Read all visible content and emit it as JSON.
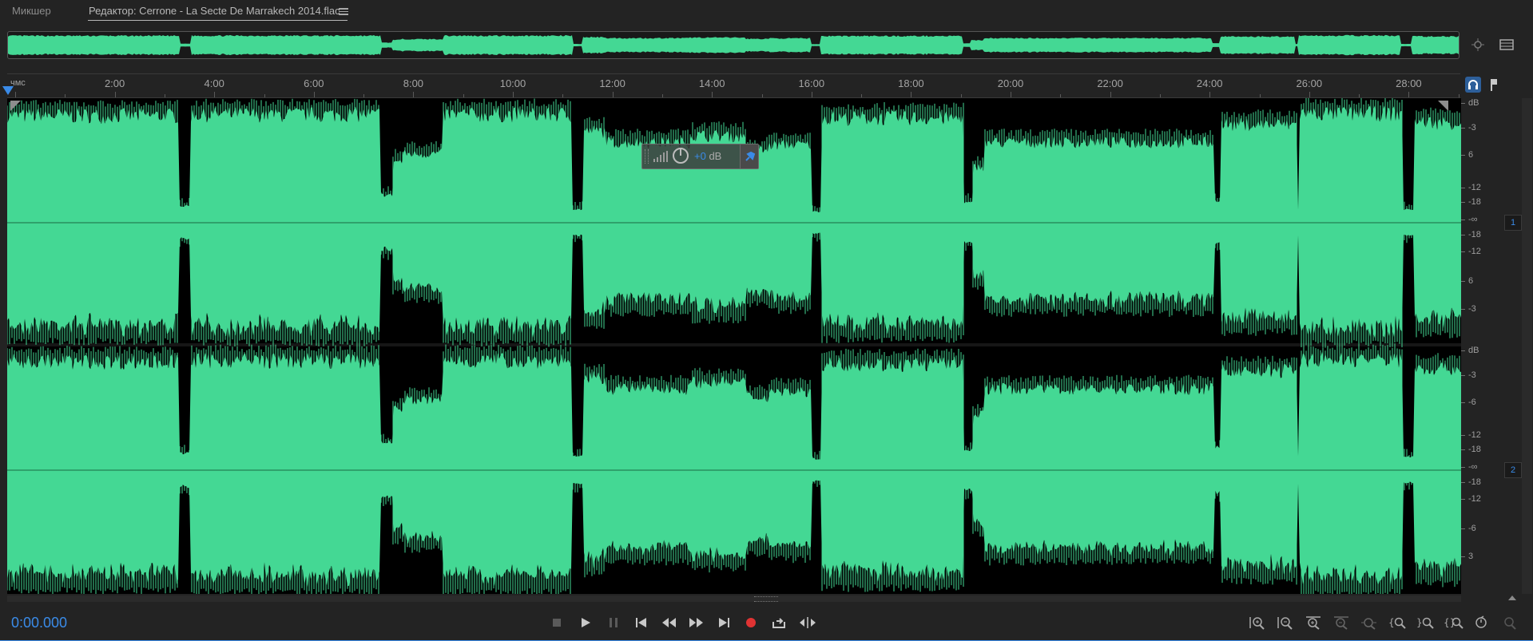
{
  "tabs": {
    "mixer_label": "Микшер",
    "editor_label": "Редактор: Cerrone - La Secte De Marrakech 2014.flac"
  },
  "ruler": {
    "unit_label": "чмс",
    "ticks": [
      "2:00",
      "4:00",
      "6:00",
      "8:00",
      "10:00",
      "12:00",
      "14:00",
      "16:00",
      "18:00",
      "20:00",
      "22:00",
      "24:00",
      "26:00",
      "28:00"
    ]
  },
  "channels": [
    {
      "badge": "1",
      "scale_labels": [
        "dB",
        "-3",
        "6",
        "-12",
        "-18",
        "-∞",
        "-18",
        "-12",
        "6",
        "-3"
      ]
    },
    {
      "badge": "2",
      "scale_labels": [
        "dB",
        "-3",
        "-6",
        "-12",
        "-18",
        "-∞",
        "-18",
        "-12",
        "-6",
        "3"
      ]
    }
  ],
  "hud": {
    "value": "+0",
    "unit": "dB"
  },
  "transport": {
    "timecode": "0:00.000",
    "buttons": [
      "stop-icon",
      "play-icon",
      "pause-icon",
      "skip-to-start-icon",
      "rewind-icon",
      "fast-forward-icon",
      "skip-to-end-icon",
      "record-icon",
      "loop-icon",
      "skip-selection-icon"
    ]
  },
  "zoom_tools": [
    "zoom-in-amplitude-icon",
    "zoom-out-amplitude-icon",
    "zoom-in-time-icon",
    "zoom-out-time-icon",
    "zoom-selection-icon",
    "zoom-in-point-icon",
    "zoom-out-point-icon",
    "zoom-full-icon",
    "zoom-reset-icon",
    "zoom-extra-icon"
  ],
  "colors": {
    "waveform": "#44d894",
    "accent": "#3a8be8",
    "record": "#e03333",
    "background": "#232323"
  }
}
